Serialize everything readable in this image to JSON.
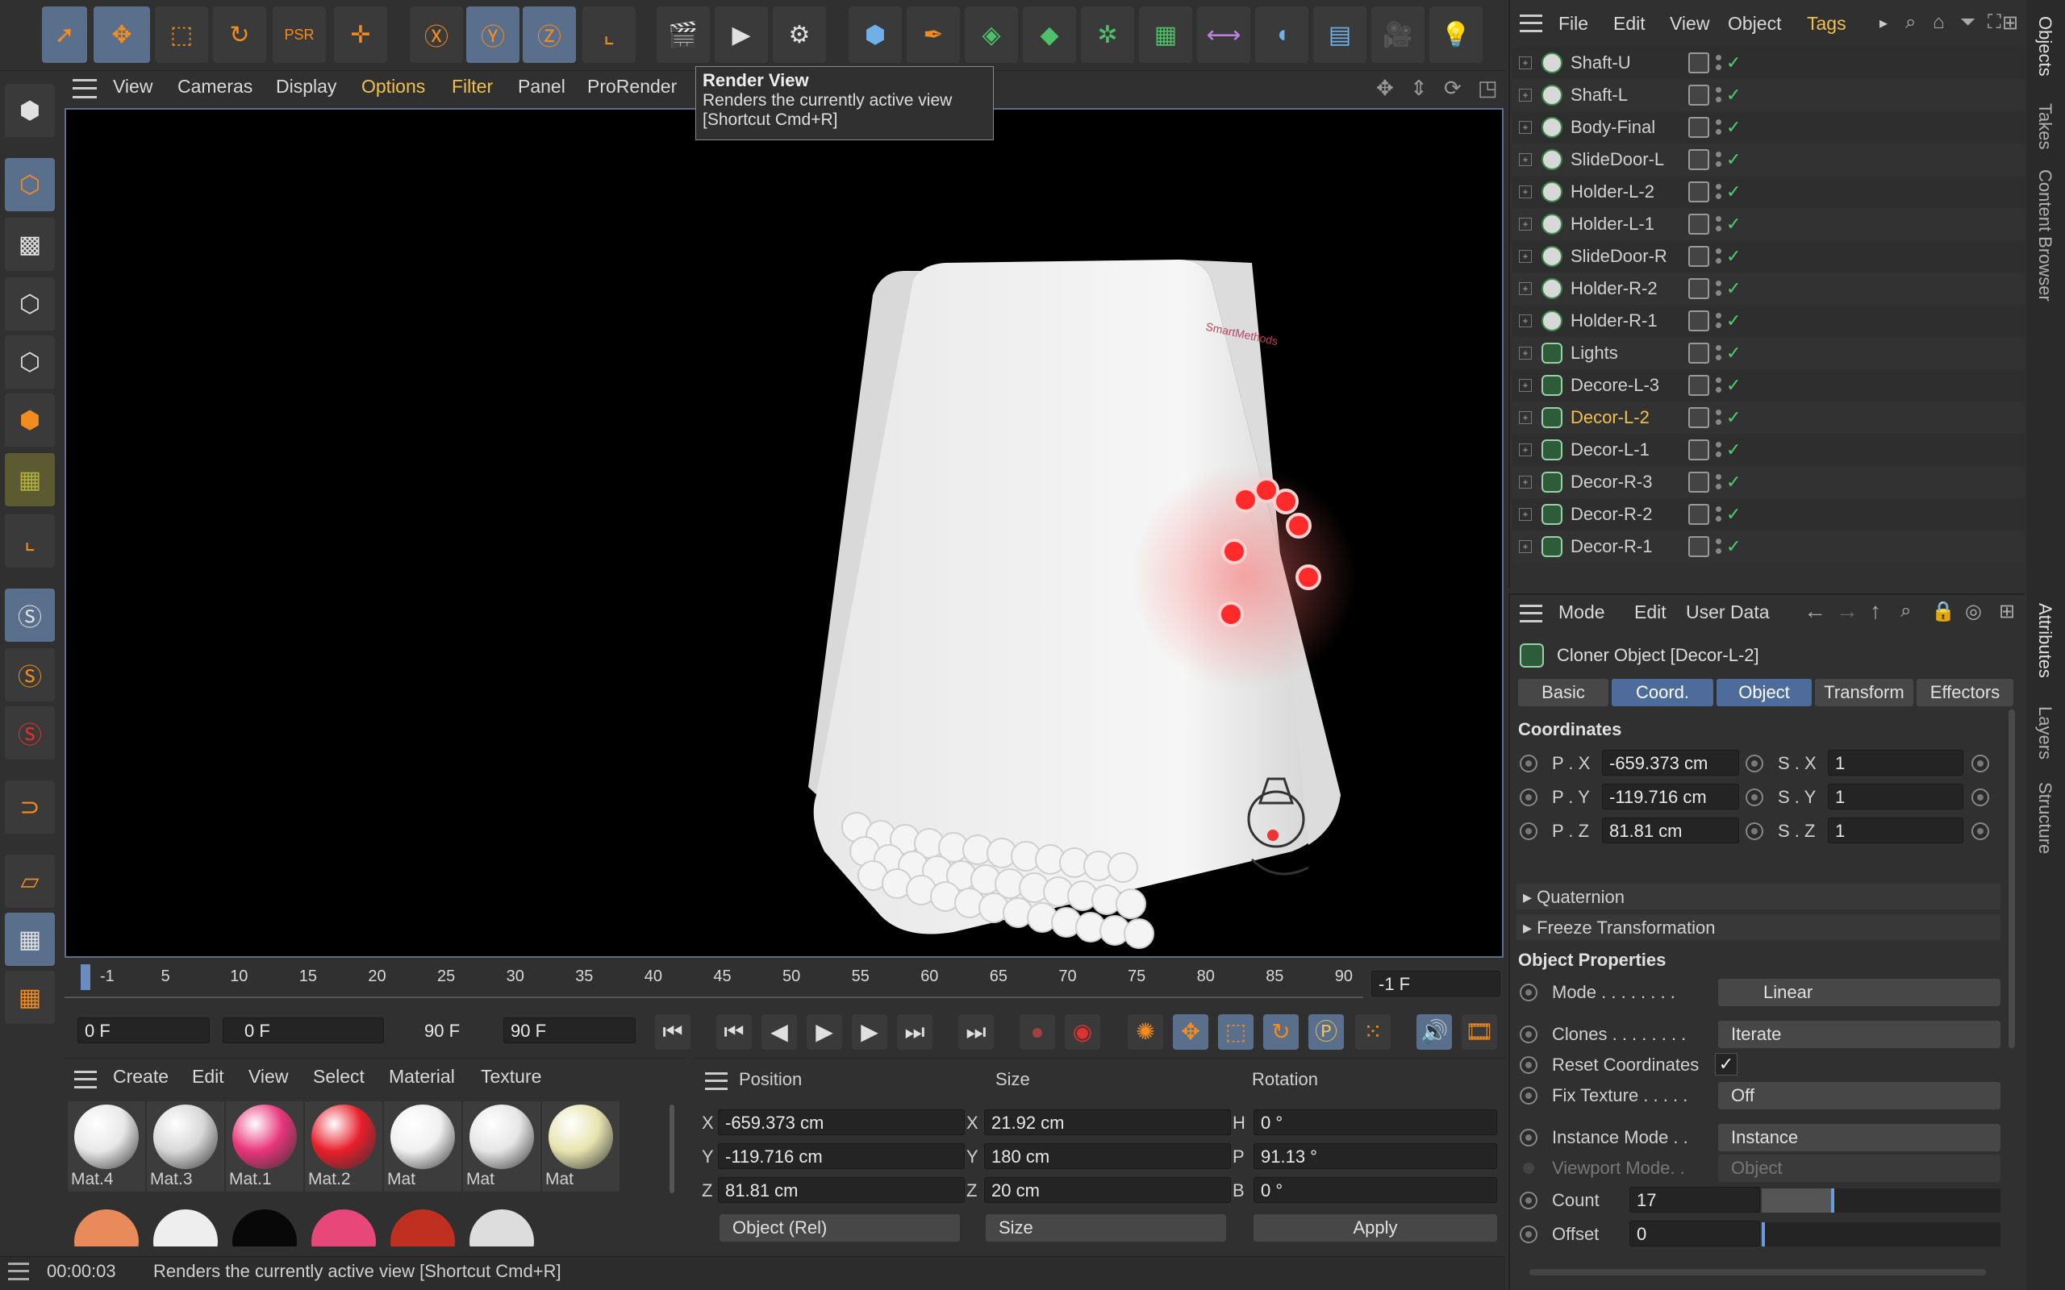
{
  "viewport_menu": [
    "View",
    "Cameras",
    "Display",
    "Options",
    "Filter",
    "Panel",
    "ProRender"
  ],
  "tooltip": {
    "title": "Render View",
    "desc": "Renders the currently active view",
    "shortcut": "[Shortcut Cmd+R]"
  },
  "object_menu": [
    "File",
    "Edit",
    "View",
    "Object",
    "Tags"
  ],
  "objects": [
    {
      "name": "Shaft-U",
      "type": "obj"
    },
    {
      "name": "Shaft-L",
      "type": "obj"
    },
    {
      "name": "Body-Final",
      "type": "obj"
    },
    {
      "name": "SlideDoor-L",
      "type": "obj"
    },
    {
      "name": "Holder-L-2",
      "type": "obj"
    },
    {
      "name": "Holder-L-1",
      "type": "obj"
    },
    {
      "name": "SlideDoor-R",
      "type": "obj"
    },
    {
      "name": "Holder-R-2",
      "type": "obj"
    },
    {
      "name": "Holder-R-1",
      "type": "obj"
    },
    {
      "name": "Lights",
      "type": "cloner"
    },
    {
      "name": "Decore-L-3",
      "type": "cloner"
    },
    {
      "name": "Decor-L-2",
      "type": "cloner",
      "selected": true
    },
    {
      "name": "Decor-L-1",
      "type": "cloner"
    },
    {
      "name": "Decor-R-3",
      "type": "cloner"
    },
    {
      "name": "Decor-R-2",
      "type": "cloner"
    },
    {
      "name": "Decor-R-1",
      "type": "cloner"
    }
  ],
  "right_tabs_top": [
    "Objects",
    "Takes",
    "Content Browser"
  ],
  "right_tabs_bottom": [
    "Attributes",
    "Layers",
    "Structure"
  ],
  "attr_menu": [
    "Mode",
    "Edit",
    "User Data"
  ],
  "attr_title": "Cloner Object [Decor-L-2]",
  "attr_tabs": [
    "Basic",
    "Coord.",
    "Object",
    "Transform",
    "Effectors"
  ],
  "coordinates": {
    "heading": "Coordinates",
    "px_label": "P . X",
    "px": "-659.373 cm",
    "py_label": "P . Y",
    "py": "-119.716 cm",
    "pz_label": "P . Z",
    "pz": "81.81 cm",
    "sx_label": "S . X",
    "sx": "1",
    "sy_label": "S . Y",
    "sy": "1",
    "sz_label": "S . Z",
    "sz": "1"
  },
  "quaternion": "Quaternion",
  "freeze": "Freeze Transformation",
  "object_properties": {
    "heading": "Object Properties",
    "mode_label": "Mode . . . . . . . .",
    "mode": "Linear",
    "clones_label": "Clones . . . . . . . .",
    "clones": "Iterate",
    "reset_label": "Reset Coordinates",
    "fix_label": "Fix Texture . . . . .",
    "fix": "Off",
    "instance_label": "Instance Mode . .",
    "instance": "Instance",
    "viewport_label": "Viewport Mode. .",
    "viewport": "Object",
    "count_label": "Count",
    "count": "17",
    "offset_label": "Offset",
    "offset": "0"
  },
  "timeline_ticks": [
    "-1",
    "5",
    "10",
    "15",
    "20",
    "25",
    "30",
    "35",
    "40",
    "45",
    "50",
    "55",
    "60",
    "65",
    "70",
    "75",
    "80",
    "85",
    "90"
  ],
  "frame_display": "-1 F",
  "transport": {
    "start": "0 F",
    "range_start": "0 F",
    "range_end": "90 F",
    "end": "90 F"
  },
  "material_menu": [
    "Create",
    "Edit",
    "View",
    "Select",
    "Material",
    "Texture"
  ],
  "materials": [
    {
      "name": "Mat.4",
      "color": "#e8e8e8"
    },
    {
      "name": "Mat.3",
      "color": "#d8d8d8"
    },
    {
      "name": "Mat.1",
      "color": "#e8357a"
    },
    {
      "name": "Mat.2",
      "color": "#e81e2a"
    },
    {
      "name": "Mat",
      "color": "#f0f0f0"
    },
    {
      "name": "Mat",
      "color": "#e6e6e6"
    },
    {
      "name": "Mat",
      "color": "#e8e4b0"
    }
  ],
  "coord_manager": {
    "position_h": "Position",
    "size_h": "Size",
    "rotation_h": "Rotation",
    "x_label": "X",
    "y_label": "Y",
    "z_label": "Z",
    "h_label": "H",
    "p_label": "P",
    "b_label": "B",
    "px": "-659.373 cm",
    "py": "-119.716 cm",
    "pz": "81.81 cm",
    "sx": "21.92 cm",
    "sy": "180 cm",
    "sz": "20 cm",
    "rh": "0 °",
    "rp": "91.13 °",
    "rb": "0 °",
    "mode": "Object (Rel)",
    "size_mode": "Size",
    "apply": "Apply"
  },
  "status": {
    "time": "00:00:03",
    "message": "Renders the currently active view [Shortcut Cmd+R]"
  },
  "logo_text": "SmartMethods"
}
